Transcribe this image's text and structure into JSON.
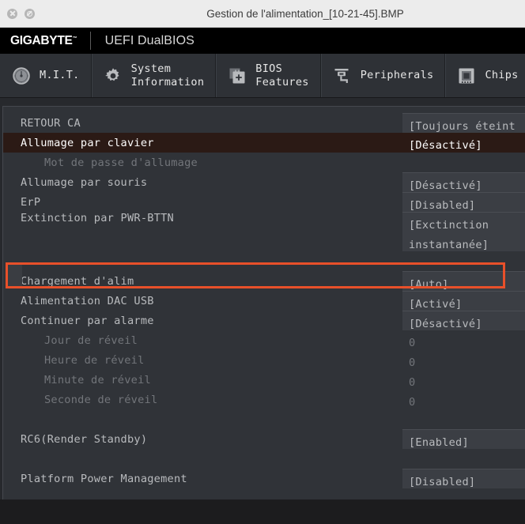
{
  "window": {
    "title": "Gestion de l'alimentation_[10-21-45].BMP",
    "buttons": [
      {
        "name": "close",
        "icon": "close-circle-icon"
      },
      {
        "name": "block",
        "icon": "block-circle-icon"
      }
    ]
  },
  "brand": {
    "logo": "GIGABYTE",
    "trademark": "™",
    "subtitle": "UEFI DualBIOS"
  },
  "tabs": [
    {
      "label": "M.I.T.",
      "icon": "gauge-dial-icon",
      "active": false
    },
    {
      "label": "System\nInformation",
      "icon": "gear-icon",
      "active": false
    },
    {
      "label": "BIOS\nFeatures",
      "icon": "chip-plus-icon",
      "active": false
    },
    {
      "label": "Peripherals",
      "icon": "peripheral-plug-icon",
      "active": false
    },
    {
      "label": "Chips",
      "icon": "chipset-icon",
      "active": false
    }
  ],
  "settings": [
    {
      "type": "item",
      "label": "RETOUR CA",
      "value": "[Toujours éteint ]",
      "dim": false,
      "sub": false,
      "selected": false,
      "boxed": true
    },
    {
      "type": "item",
      "label": "Allumage par clavier",
      "value": "[Désactivé]",
      "dim": false,
      "sub": false,
      "selected": true,
      "boxed": false
    },
    {
      "type": "item",
      "label": "Mot de passe d'allumage",
      "value": "",
      "dim": true,
      "sub": true,
      "selected": false,
      "boxed": false
    },
    {
      "type": "item",
      "label": "Allumage par souris",
      "value": "[Désactivé]",
      "dim": false,
      "sub": false,
      "selected": false,
      "boxed": true
    },
    {
      "type": "item",
      "label": "ErP",
      "value": "[Disabled]",
      "dim": false,
      "sub": false,
      "selected": false,
      "boxed": true
    },
    {
      "type": "tall",
      "label": "Extinction par PWR-BTTN",
      "value": "[Exctinction\ninstantanée]",
      "dim": false,
      "sub": false,
      "selected": false,
      "boxed": true
    },
    {
      "type": "spacer",
      "label": "",
      "value": "",
      "dim": false,
      "sub": false,
      "selected": false,
      "boxed": false
    },
    {
      "type": "item",
      "label": "Chargement d'alim",
      "value": "[Auto]",
      "dim": false,
      "sub": false,
      "selected": false,
      "boxed": true
    },
    {
      "type": "item",
      "label": "Alimentation DAC USB",
      "value": "[Activé]",
      "dim": false,
      "sub": false,
      "selected": false,
      "boxed": true
    },
    {
      "type": "item",
      "label": "Continuer par alarme",
      "value": "[Désactivé]",
      "dim": false,
      "sub": false,
      "selected": false,
      "boxed": true
    },
    {
      "type": "item",
      "label": "Jour de réveil",
      "value": "0",
      "dim": true,
      "sub": true,
      "selected": false,
      "boxed": false
    },
    {
      "type": "item",
      "label": "Heure de réveil",
      "value": "0",
      "dim": true,
      "sub": true,
      "selected": false,
      "boxed": false
    },
    {
      "type": "item",
      "label": "Minute de réveil",
      "value": "0",
      "dim": true,
      "sub": true,
      "selected": false,
      "boxed": false
    },
    {
      "type": "item",
      "label": "Seconde de réveil",
      "value": "0",
      "dim": true,
      "sub": true,
      "selected": false,
      "boxed": false
    },
    {
      "type": "spacer",
      "label": "",
      "value": "",
      "dim": false,
      "sub": false,
      "selected": false,
      "boxed": false
    },
    {
      "type": "item",
      "label": "RC6(Render Standby)",
      "value": "[Enabled]",
      "dim": false,
      "sub": false,
      "selected": false,
      "boxed": true
    },
    {
      "type": "spacer",
      "label": "",
      "value": "",
      "dim": false,
      "sub": false,
      "selected": false,
      "boxed": false
    },
    {
      "type": "item",
      "label": "Platform Power Management",
      "value": "[Disabled]",
      "dim": false,
      "sub": false,
      "selected": false,
      "boxed": true
    }
  ],
  "colors": {
    "highlight_border": "#e8502a",
    "panel_bg": "#303338",
    "value_bg": "#3b3e44",
    "selected_row_bg": "#2b1a15",
    "brand_bg": "#000000",
    "tab_bg": "#2e3136"
  }
}
